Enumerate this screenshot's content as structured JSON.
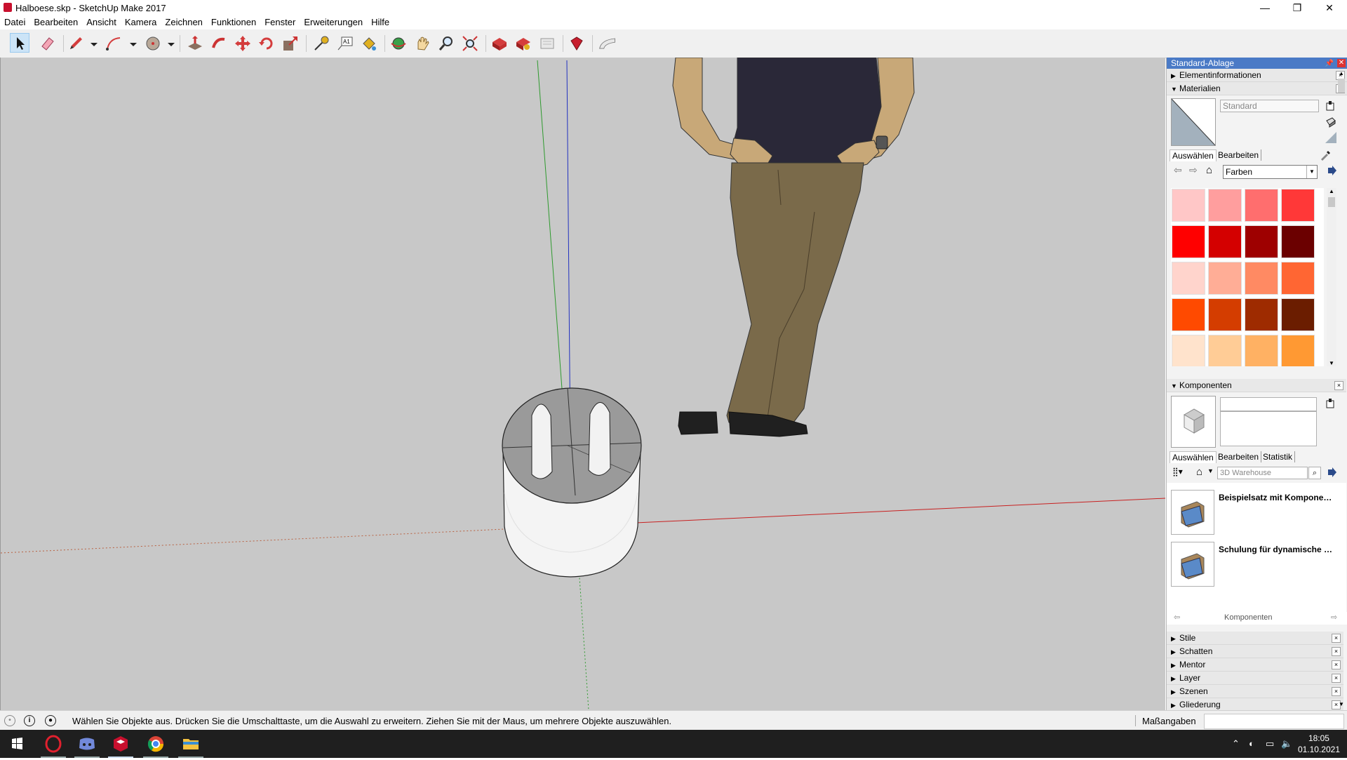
{
  "window": {
    "title": "Halboese.skp - SketchUp Make 2017",
    "minimize": "—",
    "maximize": "❐",
    "close": "✕"
  },
  "menu": [
    "Datei",
    "Bearbeiten",
    "Ansicht",
    "Kamera",
    "Zeichnen",
    "Funktionen",
    "Fenster",
    "Erweiterungen",
    "Hilfe"
  ],
  "toolbar": {
    "tools": [
      "select",
      "eraser",
      "pencil",
      "arc",
      "shapes",
      "push-pull",
      "follow-me",
      "move",
      "rotate",
      "scale",
      "tape-measure",
      "text",
      "paint-bucket",
      "orbit",
      "pan",
      "zoom",
      "zoom-extents",
      "3d-warehouse",
      "extension-warehouse",
      "layout",
      "extension-manager",
      "sandbox"
    ]
  },
  "tray": {
    "title": "Standard-Ablage",
    "sections_top": [
      {
        "label": "Elementinformationen",
        "expanded": false
      },
      {
        "label": "Materialien",
        "expanded": true
      }
    ],
    "materials": {
      "name_placeholder": "Standard",
      "tabs": [
        "Auswählen",
        "Bearbeiten"
      ],
      "collection": "Farben",
      "colors": [
        "#ffc7c7",
        "#ff9e9e",
        "#ff6e6e",
        "#ff3838",
        "#ff0000",
        "#d40000",
        "#9e0000",
        "#6b0000",
        "#ffd4cc",
        "#ffad96",
        "#ff8a63",
        "#ff6633",
        "#ff4a00",
        "#d43d00",
        "#9e2b00",
        "#6b1d00",
        "#ffe3cc",
        "#ffcc96",
        "#ffb163",
        "#ff9933"
      ]
    },
    "components": {
      "label": "Komponenten",
      "tabs": [
        "Auswählen",
        "Bearbeiten",
        "Statistik"
      ],
      "search_placeholder": "3D Warehouse",
      "items": [
        "Beispielsatz mit Kompone…",
        "Schulung für dynamische …"
      ],
      "footer": "Komponenten"
    },
    "sections_bottom": [
      "Stile",
      "Schatten",
      "Mentor",
      "Layer",
      "Szenen",
      "Gliederung"
    ]
  },
  "status": {
    "message": "Wählen Sie Objekte aus. Drücken Sie die Umschalttaste, um die Auswahl zu erweitern. Ziehen Sie mit der Maus, um mehrere Objekte auszuwählen.",
    "measure_label": "Maßangaben",
    "measure_value": ""
  },
  "taskbar": {
    "apps": [
      "windows-start",
      "opera",
      "discord",
      "sketchup",
      "chrome",
      "file-explorer"
    ],
    "time": "18:05",
    "date": "01.10.2021"
  }
}
